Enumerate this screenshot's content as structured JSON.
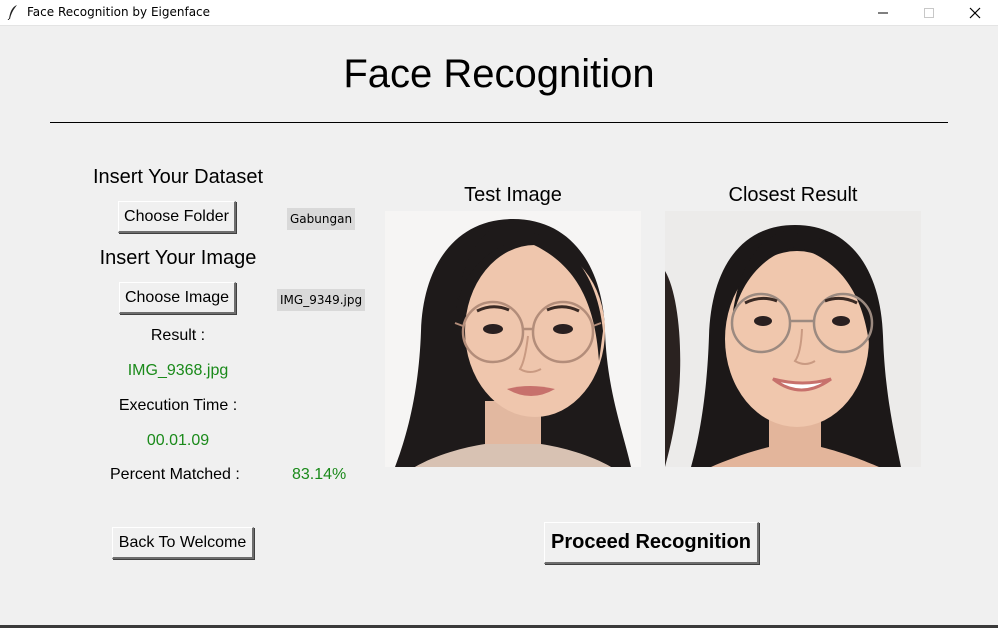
{
  "window": {
    "title": "Face Recognition by Eigenface",
    "icon": "feather-icon",
    "controls": [
      "minimize-icon",
      "maximize-icon",
      "close-icon"
    ]
  },
  "page": {
    "heading": "Face Recognition"
  },
  "dataset": {
    "label": "Insert Your Dataset",
    "button": "Choose Folder",
    "selected": "Gabungan"
  },
  "image": {
    "label": "Insert Your Image",
    "button": "Choose Image",
    "selected": "IMG_9349.jpg"
  },
  "result": {
    "label": "Result :",
    "value": "IMG_9368.jpg",
    "time_label": "Execution Time :",
    "time_value": "00.01.09",
    "percent_label": "Percent Matched :",
    "percent_value": "83.14%"
  },
  "panels": {
    "test_title": "Test Image",
    "result_title": "Closest Result"
  },
  "actions": {
    "back": "Back To Welcome",
    "proceed": "Proceed Recognition"
  },
  "colors": {
    "accent_green": "#1a8a1a",
    "background": "#f0f0f0"
  }
}
